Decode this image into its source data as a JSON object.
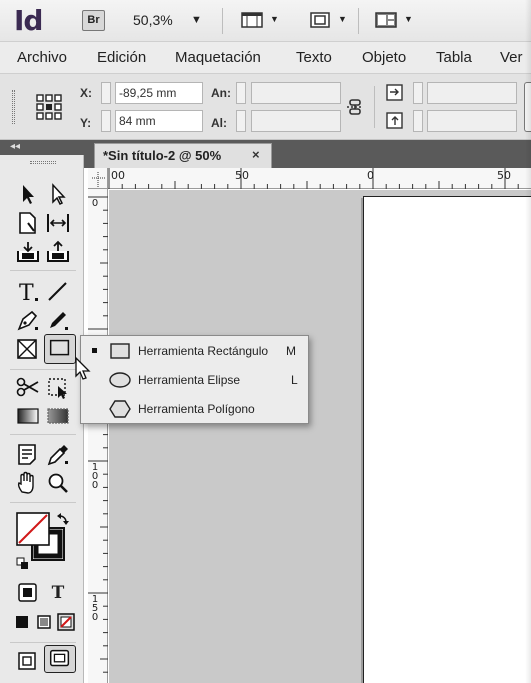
{
  "app": {
    "logo": "Id",
    "bridge_label": "Br",
    "zoom": "50,3%",
    "caret": "▼"
  },
  "menu": {
    "items": [
      "Archivo",
      "Edición",
      "Maquetación",
      "Texto",
      "Objeto",
      "Tabla",
      "Ver"
    ]
  },
  "control": {
    "x_label": "X:",
    "x_value": "-89,25 mm",
    "y_label": "Y:",
    "y_value": "84 mm",
    "w_label": "An:",
    "w_value": "",
    "h_label": "Al:",
    "h_value": ""
  },
  "document": {
    "tab_label": "*Sin título-2 @ 50%",
    "close_glyph": "×",
    "collapse_glyph": "◂◂"
  },
  "rulers": {
    "h_labels": [
      "00",
      "50",
      "0",
      "50"
    ],
    "v_labels": [
      "0",
      "1\n0\n0",
      "1\n5\n0"
    ]
  },
  "flyout": {
    "items": [
      {
        "label": "Herramienta Rectángulo",
        "shortcut": "M",
        "selected": true
      },
      {
        "label": "Herramienta Elipse",
        "shortcut": "L",
        "selected": false
      },
      {
        "label": "Herramienta Polígono",
        "shortcut": "",
        "selected": false
      }
    ]
  },
  "swatch": {
    "type_glyph": "T"
  },
  "colors": {
    "logo": "#3b2a52",
    "pasteboard": "#c9c9c9",
    "tab_strip": "#5a5a5a",
    "none_stroke": "#d11919"
  }
}
